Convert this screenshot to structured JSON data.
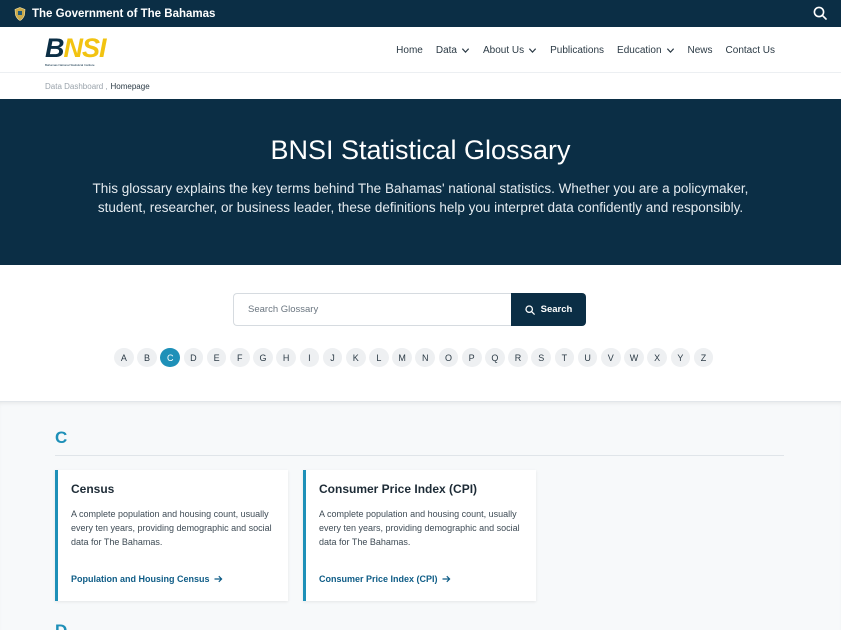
{
  "gov_bar": {
    "title": "The Government of The Bahamas"
  },
  "logo": {
    "text_dark": "B",
    "text_accent": "NSI",
    "subtitle": "Bahamas National Statistical Institute"
  },
  "nav": {
    "items": [
      {
        "label": "Home",
        "has_dropdown": false
      },
      {
        "label": "Data",
        "has_dropdown": true
      },
      {
        "label": "About Us",
        "has_dropdown": true
      },
      {
        "label": "Publications",
        "has_dropdown": false
      },
      {
        "label": "Education",
        "has_dropdown": true
      },
      {
        "label": "News",
        "has_dropdown": false
      },
      {
        "label": "Contact Us",
        "has_dropdown": false
      }
    ]
  },
  "breadcrumb": {
    "parent": "Data Dashboard",
    "separator": ",",
    "current": "Homepage"
  },
  "hero": {
    "title": "BNSI Statistical Glossary",
    "description": "This glossary explains the key terms behind The Bahamas' national statistics. Whether you are a policymaker, student, researcher, or business leader, these definitions help you interpret data confidently and responsibly."
  },
  "search": {
    "placeholder": "Search Glossary",
    "button_label": "Search"
  },
  "alphabet": {
    "letters": [
      "A",
      "B",
      "C",
      "D",
      "E",
      "F",
      "G",
      "H",
      "I",
      "J",
      "K",
      "L",
      "M",
      "N",
      "O",
      "P",
      "Q",
      "R",
      "S",
      "T",
      "U",
      "V",
      "W",
      "X",
      "Y",
      "Z"
    ],
    "active": "C"
  },
  "section": {
    "letter": "C",
    "cards": [
      {
        "title": "Census",
        "description": "A complete population and housing count, usually every ten years, providing demographic and social data for The Bahamas.",
        "link": "Population and Housing Census"
      },
      {
        "title": "Consumer Price Index (CPI)",
        "description": "A complete population and housing count, usually every ten years, providing demographic and social data for The Bahamas.",
        "link": "Consumer Price Index (CPI)"
      }
    ]
  },
  "next_section": {
    "letter": "D"
  },
  "colors": {
    "navy": "#0b2e45",
    "accent": "#1e90b8",
    "link": "#0e5c86",
    "logo_yellow": "#f2c311"
  }
}
